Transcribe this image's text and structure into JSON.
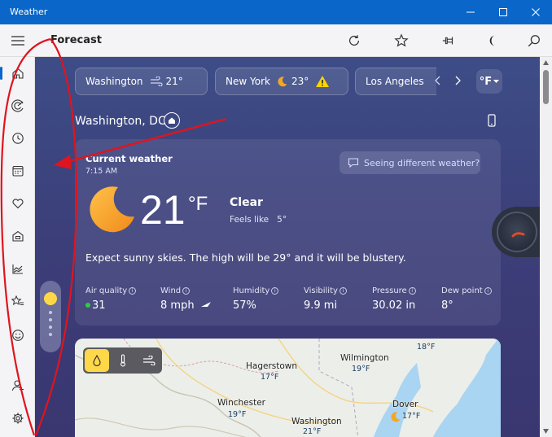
{
  "window": {
    "title": "Weather",
    "controls": [
      "minimize",
      "maximize",
      "close"
    ]
  },
  "header": {
    "page_title": "Forecast",
    "icons": [
      "refresh-icon",
      "star-icon",
      "pin-icon",
      "dark-mode-icon",
      "search-icon"
    ]
  },
  "sidebar": {
    "items": [
      {
        "name": "home",
        "icon": "home-icon",
        "active": true
      },
      {
        "name": "radar",
        "icon": "radar-icon"
      },
      {
        "name": "hourly",
        "icon": "clock-icon"
      },
      {
        "name": "monthly",
        "icon": "calendar-icon"
      },
      {
        "name": "health",
        "icon": "heart-icon"
      },
      {
        "name": "outdoor",
        "icon": "house-icon"
      },
      {
        "name": "trends",
        "icon": "chart-icon"
      },
      {
        "name": "favorites",
        "icon": "star-list-icon"
      },
      {
        "name": "feedback",
        "icon": "smiley-icon"
      },
      {
        "name": "account",
        "icon": "person-add-icon"
      },
      {
        "name": "settings",
        "icon": "gear-icon"
      }
    ]
  },
  "locations": [
    {
      "name": "Washington",
      "temp": "21°",
      "icon": "windy-icon"
    },
    {
      "name": "New York",
      "temp": "23°",
      "icon": "moon-icon",
      "alert": true
    },
    {
      "name": "Los Angeles",
      "temp": "",
      "icon": "cloudy-moon-icon"
    }
  ],
  "unit": "°F",
  "current": {
    "city": "Washington, DC",
    "title": "Current weather",
    "time": "7:15 AM",
    "feedback_link": "Seeing different weather?",
    "temp": "21",
    "temp_unit": "°F",
    "condition": "Clear",
    "feels_like_label": "Feels like",
    "feels_like": "5°",
    "summary": "Expect sunny skies. The high will be 29° and it will be blustery.",
    "stats": [
      {
        "label": "Air quality",
        "value": "31"
      },
      {
        "label": "Wind",
        "value": "8 mph"
      },
      {
        "label": "Humidity",
        "value": "57%"
      },
      {
        "label": "Visibility",
        "value": "9.9 mi"
      },
      {
        "label": "Pressure",
        "value": "30.02 in"
      },
      {
        "label": "Dew point",
        "value": "8°"
      }
    ]
  },
  "map": {
    "places": [
      {
        "name": "Hagerstown",
        "temp": "17°F"
      },
      {
        "name": "Wilmington",
        "temp": "19°F"
      },
      {
        "name": "Winchester",
        "temp": "19°F"
      },
      {
        "name": "Dover",
        "temp": "17°F"
      },
      {
        "name": "Washington",
        "temp": "21°F"
      },
      {
        "name": "",
        "temp": "18°F"
      }
    ]
  },
  "colors": {
    "titlebar": "#0a66c8",
    "accent_moon": "#f5a623",
    "air_quality_dot": "#2ecc40",
    "annotation": "#e0141e"
  }
}
